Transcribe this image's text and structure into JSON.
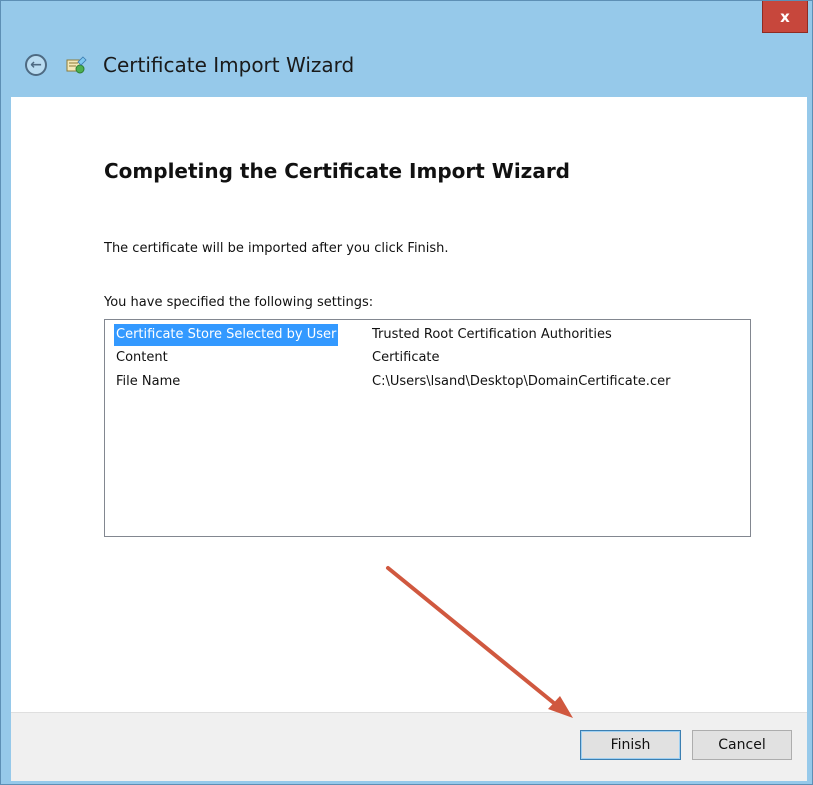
{
  "window": {
    "close_label": "x",
    "title": "Certificate Import Wizard"
  },
  "page": {
    "heading": "Completing the Certificate Import Wizard",
    "description": "The certificate will be imported after you click Finish.",
    "settings_label": "You have specified the following settings:"
  },
  "settings": [
    {
      "key": "Certificate Store Selected by User",
      "value": "Trusted Root Certification Authorities",
      "selected": true
    },
    {
      "key": "Content",
      "value": "Certificate",
      "selected": false
    },
    {
      "key": "File Name",
      "value": "C:\\Users\\lsand\\Desktop\\DomainCertificate.cer",
      "selected": false
    }
  ],
  "buttons": {
    "finish": "Finish",
    "cancel": "Cancel"
  },
  "icons": {
    "back": "back-arrow-icon",
    "certificate": "certificate-icon",
    "close": "close-icon"
  },
  "colors": {
    "frame": "#96c9ea",
    "close_button": "#c7473c",
    "selection": "#3399ff",
    "annotation_arrow": "#d0583f"
  }
}
